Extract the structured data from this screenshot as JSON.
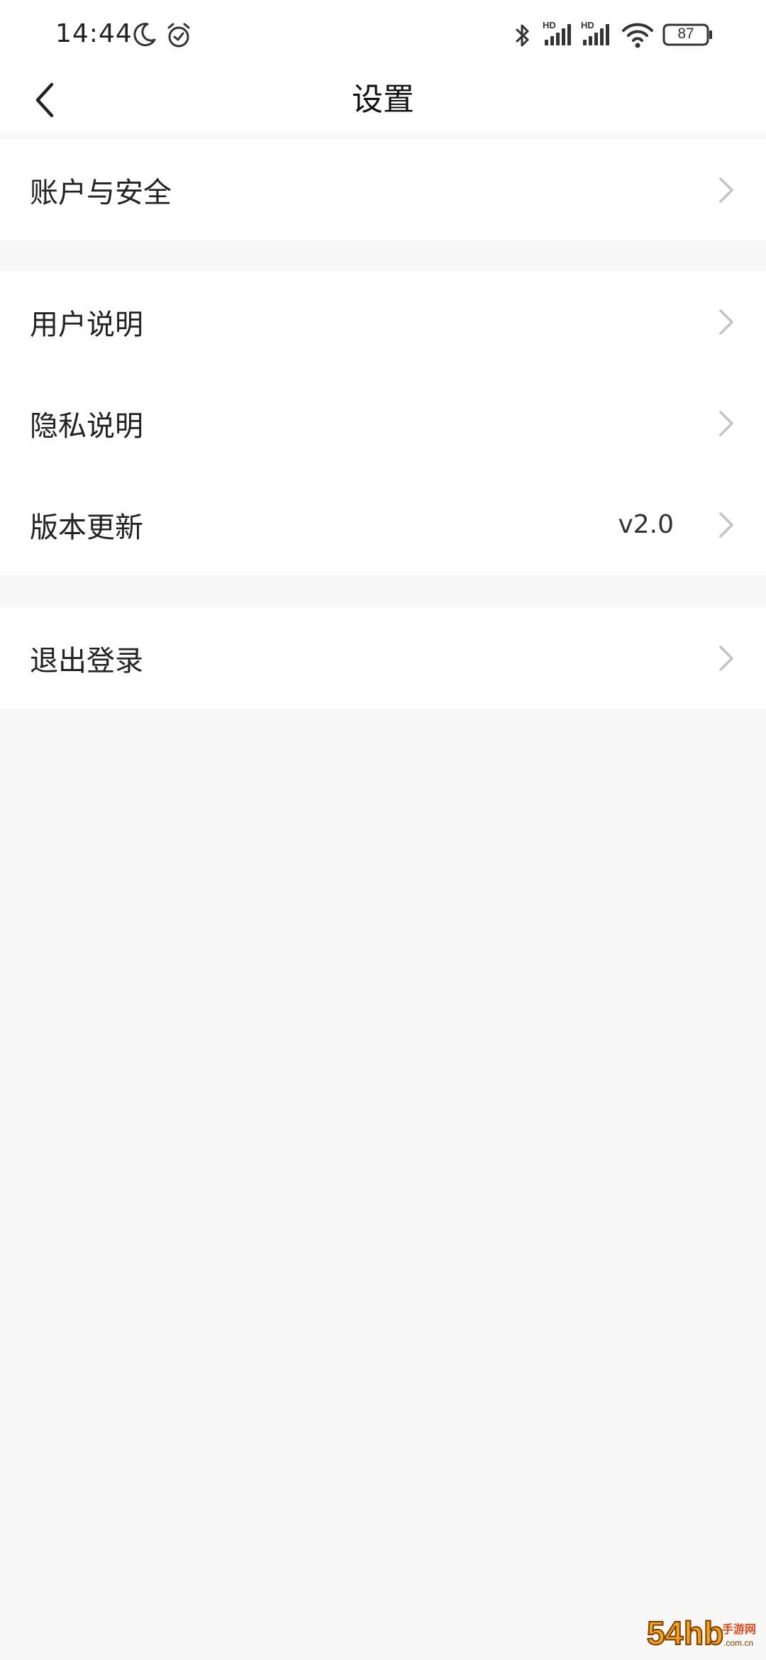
{
  "status_bar": {
    "time": "14:44",
    "battery": "87",
    "icons": [
      "moon-icon",
      "alarm-icon",
      "bluetooth-icon",
      "signal-hd-icon",
      "signal-hd-icon",
      "wifi-icon",
      "battery-icon"
    ],
    "signal_label": "HD"
  },
  "header": {
    "title": "设置",
    "back_icon": "back-arrow-icon"
  },
  "groups": [
    {
      "items": [
        {
          "label": "账户与安全",
          "value": ""
        }
      ]
    },
    {
      "items": [
        {
          "label": "用户说明",
          "value": ""
        },
        {
          "label": "隐私说明",
          "value": ""
        },
        {
          "label": "版本更新",
          "value": "v2.0"
        }
      ]
    },
    {
      "items": [
        {
          "label": "退出登录",
          "value": ""
        }
      ]
    }
  ],
  "watermark": {
    "text": "54hb手游网",
    "sub": ".com.cn"
  },
  "colors": {
    "background": "#f7f7f7",
    "surface": "#ffffff",
    "text": "#222222",
    "chevron": "#c4c4c4"
  }
}
